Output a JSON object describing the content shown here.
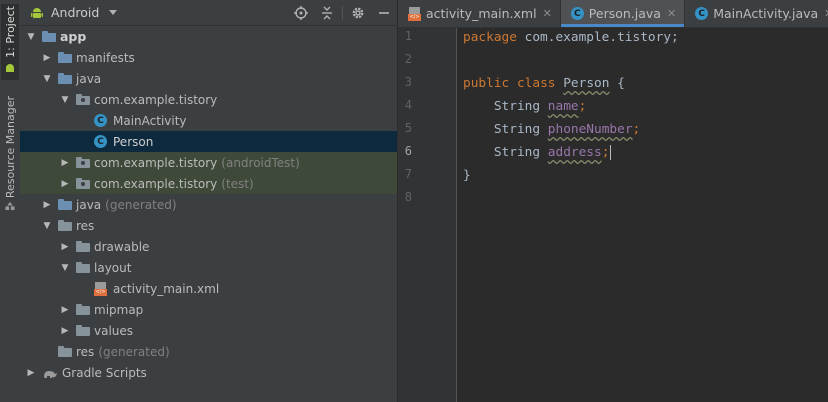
{
  "sidebar_tabs": [
    {
      "label": "1: Project",
      "icon": "android-icon"
    },
    {
      "label": "Resource Manager",
      "icon": "resource-manager-icon"
    }
  ],
  "project_panel": {
    "view_mode": "Android",
    "tree": [
      {
        "label": "app",
        "icon": "app-folder-icon",
        "expanded": true
      },
      {
        "label": "manifests",
        "icon": "folder-icon",
        "expanded": false
      },
      {
        "label": "java",
        "icon": "folder-icon",
        "expanded": true
      },
      {
        "label": "com.example.tistory",
        "icon": "package-icon",
        "expanded": true
      },
      {
        "label": "MainActivity",
        "icon": "class-icon"
      },
      {
        "label": "Person",
        "icon": "class-icon",
        "selected": true
      },
      {
        "label": "com.example.tistory",
        "suffix": "(androidTest)",
        "icon": "package-icon",
        "expanded": false
      },
      {
        "label": "com.example.tistory",
        "suffix": "(test)",
        "icon": "package-icon",
        "expanded": false
      },
      {
        "label": "java",
        "suffix": "(generated)",
        "icon": "generated-folder-icon",
        "expanded": false
      },
      {
        "label": "res",
        "icon": "res-folder-icon",
        "expanded": true
      },
      {
        "label": "drawable",
        "icon": "folder-icon",
        "expanded": false
      },
      {
        "label": "layout",
        "icon": "folder-icon",
        "expanded": true
      },
      {
        "label": "activity_main.xml",
        "icon": "xml-file-icon"
      },
      {
        "label": "mipmap",
        "icon": "folder-icon",
        "expanded": false
      },
      {
        "label": "values",
        "icon": "folder-icon",
        "expanded": false
      },
      {
        "label": "res",
        "suffix": "(generated)",
        "icon": "res-folder-icon"
      },
      {
        "label": "Gradle Scripts",
        "icon": "gradle-icon",
        "expanded": false
      }
    ]
  },
  "editor_tabs": [
    {
      "label": "activity_main.xml",
      "icon": "xml-file-icon",
      "active": false
    },
    {
      "label": "Person.java",
      "icon": "class-icon",
      "active": true
    },
    {
      "label": "MainActivity.java",
      "icon": "class-icon",
      "active": false
    }
  ],
  "editor": {
    "line_numbers": [
      "1",
      "2",
      "3",
      "4",
      "5",
      "6",
      "7",
      "8"
    ],
    "current_line": "6",
    "code": {
      "l1_kw": "package",
      "l1_rest": " com.example.tistory;",
      "l3_kw1": "public",
      "l3_kw2": "class",
      "l3_name": "Person",
      "l3_brace": " {",
      "l4_type": "String",
      "l4_field": "name",
      "l5_type": "String",
      "l5_field": "phoneNumber",
      "l6_type": "String",
      "l6_field": "address",
      "semicolon": ";",
      "l7_brace": "}"
    }
  },
  "colors": {
    "keyword": "#cc7832",
    "field": "#9876aa",
    "selection": "#0d293e",
    "test_highlight": "#3f4939",
    "tab_accent": "#4a88c7"
  }
}
